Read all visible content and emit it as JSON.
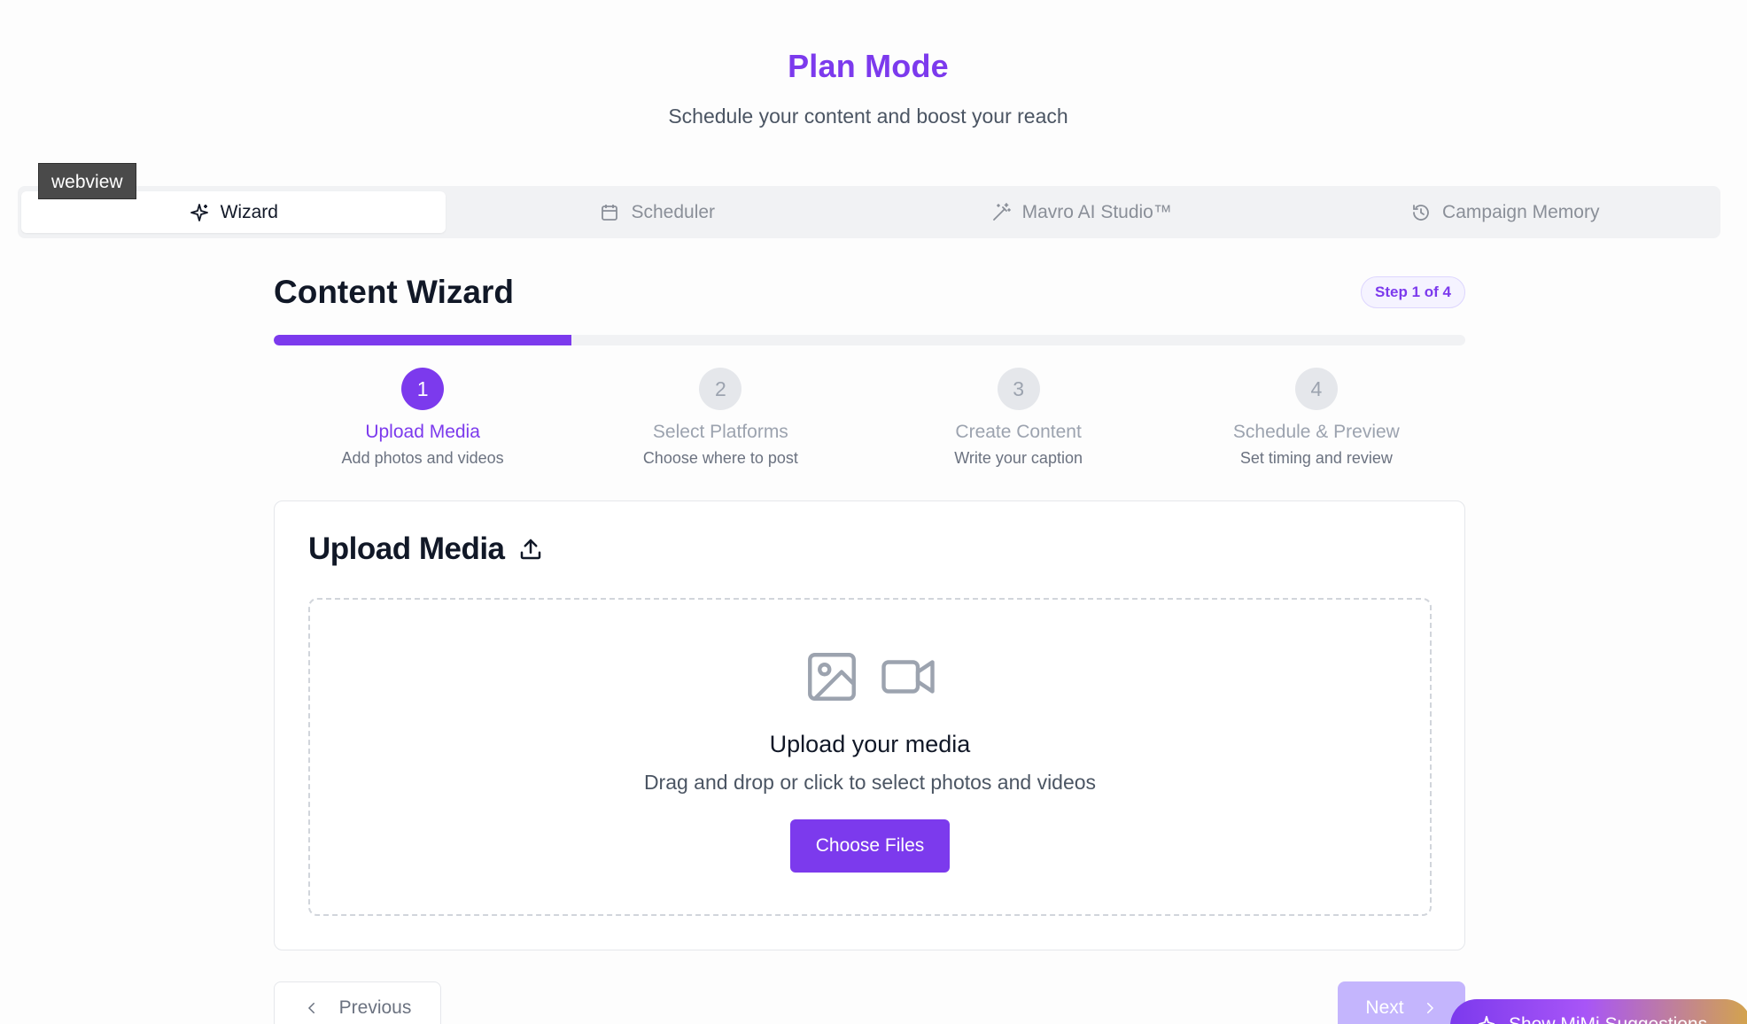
{
  "header": {
    "title": "Plan Mode",
    "subtitle": "Schedule your content and boost your reach"
  },
  "webview_tag": "webview",
  "tabs": [
    {
      "label": "Wizard",
      "icon": "sparkles-icon",
      "active": true
    },
    {
      "label": "Scheduler",
      "icon": "calendar-icon",
      "active": false
    },
    {
      "label": "Mavro AI Studio™",
      "icon": "magic-wand-icon",
      "active": false
    },
    {
      "label": "Campaign Memory",
      "icon": "history-icon",
      "active": false
    }
  ],
  "wizard": {
    "title": "Content Wizard",
    "step_badge": "Step 1 of 4",
    "progress_percent": 25,
    "steps": [
      {
        "number": "1",
        "title": "Upload Media",
        "subtitle": "Add photos and videos"
      },
      {
        "number": "2",
        "title": "Select Platforms",
        "subtitle": "Choose where to post"
      },
      {
        "number": "3",
        "title": "Create Content",
        "subtitle": "Write your caption"
      },
      {
        "number": "4",
        "title": "Schedule & Preview",
        "subtitle": "Set timing and review"
      }
    ]
  },
  "upload": {
    "title": "Upload Media",
    "drop_title": "Upload your media",
    "drop_subtitle": "Drag and drop or click to select photos and videos",
    "choose_label": "Choose Files"
  },
  "nav": {
    "previous_label": "Previous",
    "next_label": "Next"
  },
  "mimi": {
    "label": "Show MiMi Suggestions"
  },
  "colors": {
    "accent": "#7c3aed",
    "accent_light": "#c4b5fd"
  }
}
